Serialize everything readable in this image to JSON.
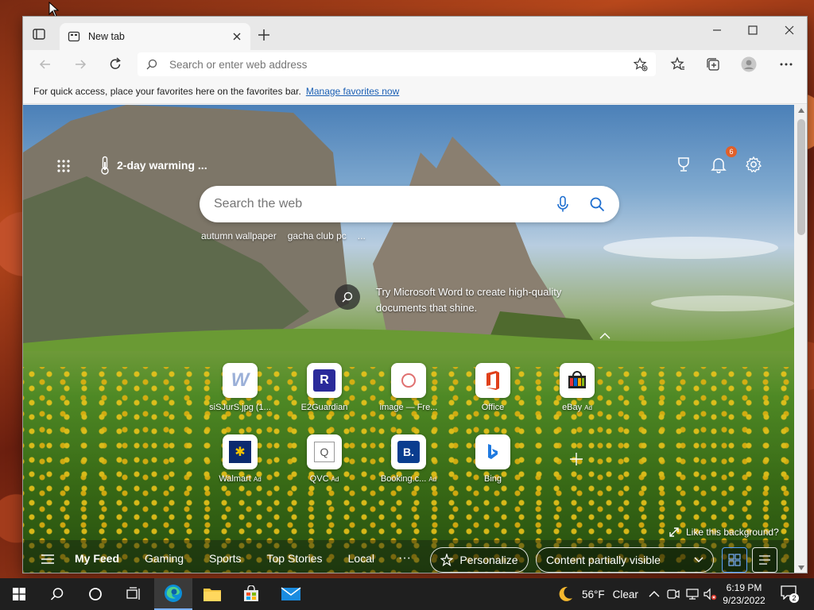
{
  "browser": {
    "tab_title": "New tab",
    "address_placeholder": "Search or enter web address",
    "favbar_text": "For quick access, place your favorites here on the favorites bar.",
    "favbar_link": "Manage favorites now"
  },
  "newtab": {
    "weather_text": "2-day warming ...",
    "notification_count": "6",
    "search_placeholder": "Search the web",
    "trending": [
      "autumn wallpaper",
      "gacha club pc",
      "..."
    ],
    "promo_text": "Try Microsoft Word to create high-quality documents that shine.",
    "tiles": [
      {
        "label": "siSJurS.jpg (1...",
        "ad": "",
        "glyph": "W",
        "color": "#9bb0d8"
      },
      {
        "label": "E2Guardian",
        "ad": "",
        "glyph": "R",
        "color": "#2a2a9a"
      },
      {
        "label": "image — Fre...",
        "ad": "",
        "glyph": "◉",
        "color": "#e07070"
      },
      {
        "label": "Office",
        "ad": "",
        "glyph": "O",
        "color": "#e0401a"
      },
      {
        "label": "eBay",
        "ad": "Ad",
        "glyph": "🛍",
        "color": "#333333"
      },
      {
        "label": "Walmart",
        "ad": "Ad",
        "glyph": "✱",
        "color": "#f2c200"
      },
      {
        "label": "QVC",
        "ad": "Ad",
        "glyph": "Q",
        "color": "#555555"
      },
      {
        "label": "Booking.c...",
        "ad": "Ad",
        "glyph": "B.",
        "color": "#0a3d8f"
      },
      {
        "label": "Bing",
        "ad": "",
        "glyph": "b",
        "color": "#1f7ae0"
      }
    ],
    "like_background": "Like this background?",
    "feed_tabs": [
      "My Feed",
      "Gaming",
      "Sports",
      "Top Stories",
      "Local"
    ],
    "feed_more": "···",
    "personalize_label": "Personalize",
    "content_visibility": "Content partially visible"
  },
  "taskbar": {
    "weather_temp": "56°F",
    "weather_desc": "Clear",
    "time": "6:19 PM",
    "date": "9/23/2022",
    "notification_count": "2"
  },
  "colors": {
    "accent": "#1a5fb4",
    "badge": "#e0602a",
    "taskbar": "#1f1f1f"
  }
}
